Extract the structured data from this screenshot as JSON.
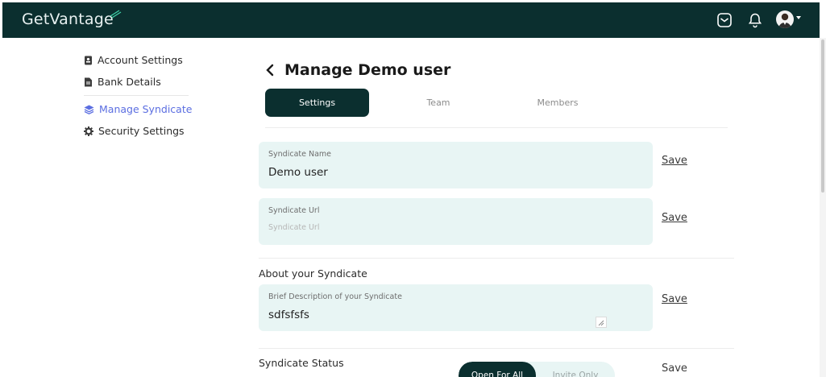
{
  "app": {
    "brand": "GetVantage"
  },
  "sidebar": {
    "items": [
      {
        "label": "Account Settings",
        "icon": "badge-icon"
      },
      {
        "label": "Bank Details",
        "icon": "document-icon"
      },
      {
        "label": "Manage Syndicate",
        "icon": "layers-icon",
        "active": true
      },
      {
        "label": "Security Settings",
        "icon": "gear-icon"
      }
    ]
  },
  "page": {
    "title": "Manage Demo user",
    "tabs": [
      {
        "label": "Settings",
        "active": true
      },
      {
        "label": "Team"
      },
      {
        "label": "Members"
      }
    ]
  },
  "fields": {
    "syndicate_name": {
      "label": "Syndicate Name",
      "value": "Demo user"
    },
    "syndicate_url": {
      "label": "Syndicate Url",
      "value": "",
      "placeholder": "Syndicate Url"
    },
    "about_heading": "About your Syndicate",
    "description": {
      "label": "Brief Description of your Syndicate",
      "value": "sdfsfsfs"
    },
    "status_heading": "Syndicate Status"
  },
  "status_options": {
    "open": "Open For All",
    "invite": "Invite Only"
  },
  "actions": {
    "save_label": "Save"
  },
  "colors": {
    "brand_dark": "#0b2f2f",
    "field_bg": "#e8f5f4",
    "accent_active": "#5b6ee1"
  }
}
